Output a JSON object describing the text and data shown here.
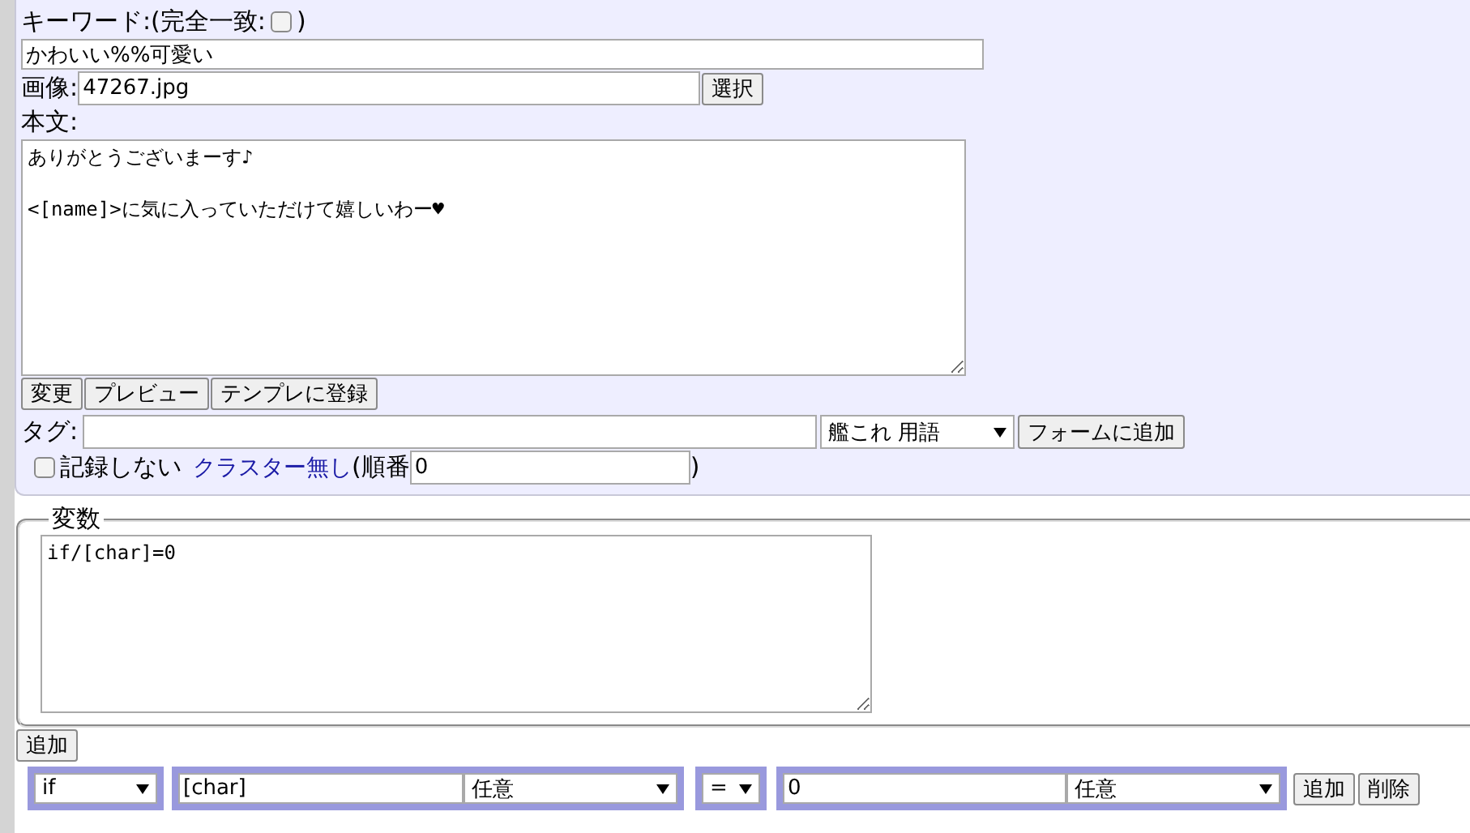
{
  "keyword": {
    "label": "キーワード:(完全一致:",
    "exact_checked": false,
    "close": ")",
    "value": "かわいい%%可愛い"
  },
  "image": {
    "label": "画像:",
    "value": "47267.jpg",
    "button": "選択"
  },
  "body": {
    "label": "本文:",
    "value": "ありがとうございまーす♪\n\n<[name]>に気に入っていただけて嬉しいわー♥"
  },
  "form_buttons": [
    "変更",
    "プレビュー",
    "テンプレに登録"
  ],
  "tag": {
    "label": "タグ:",
    "select": "艦これ 用語",
    "button": "フォームに追加"
  },
  "options": {
    "no_record": {
      "label": "記録しない",
      "checked": false
    },
    "cluster_link": "クラスター無し",
    "order_label": "(順番",
    "order_value": "0",
    "close": ")"
  },
  "variables": {
    "legend": "変数",
    "value": "if/[char]=0",
    "add_button": "追加"
  },
  "condition": {
    "type": "if",
    "variable": "[char]",
    "variable_mode": "任意",
    "operator": "=",
    "value": "0",
    "value_mode": "任意",
    "buttons": [
      "追加",
      "削除"
    ]
  }
}
